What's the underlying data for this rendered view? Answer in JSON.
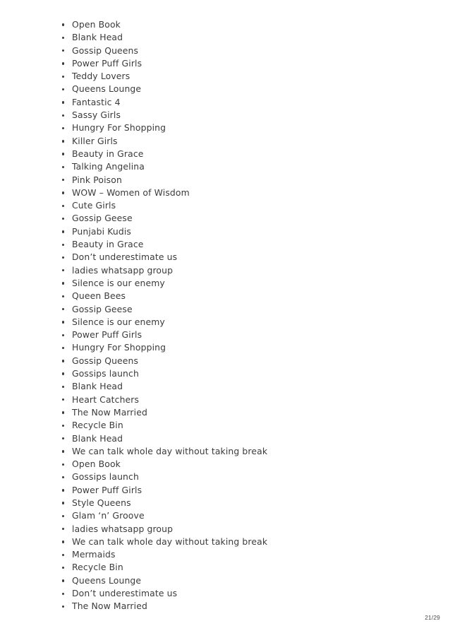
{
  "document": {
    "bullet_icon": "bullet-dot-icon",
    "list": {
      "items": [
        {
          "label": "Open Book"
        },
        {
          "label": "Blank Head"
        },
        {
          "label": "Gossip Queens"
        },
        {
          "label": "Power Puff Girls"
        },
        {
          "label": "Teddy Lovers"
        },
        {
          "label": "Queens Lounge"
        },
        {
          "label": "Fantastic 4"
        },
        {
          "label": "Sassy Girls"
        },
        {
          "label": "Hungry For Shopping"
        },
        {
          "label": "Killer Girls"
        },
        {
          "label": "Beauty in Grace"
        },
        {
          "label": "Talking Angelina"
        },
        {
          "label": "Pink Poison"
        },
        {
          "label": "WOW – Women of Wisdom"
        },
        {
          "label": "Cute Girls"
        },
        {
          "label": "Gossip Geese"
        },
        {
          "label": "Punjabi Kudis"
        },
        {
          "label": "Beauty in Grace"
        },
        {
          "label": "Don’t underestimate us"
        },
        {
          "label": "ladies whatsapp group"
        },
        {
          "label": "Silence is our enemy"
        },
        {
          "label": "Queen Bees"
        },
        {
          "label": "Gossip Geese"
        },
        {
          "label": "Silence is our enemy"
        },
        {
          "label": "Power Puff Girls"
        },
        {
          "label": "Hungry For Shopping"
        },
        {
          "label": "Gossip Queens"
        },
        {
          "label": "Gossips launch"
        },
        {
          "label": "Blank Head"
        },
        {
          "label": "Heart Catchers"
        },
        {
          "label": "The Now Married"
        },
        {
          "label": "Recycle Bin"
        },
        {
          "label": "Blank Head"
        },
        {
          "label": "We can talk whole day without taking break"
        },
        {
          "label": "Open Book"
        },
        {
          "label": "Gossips launch"
        },
        {
          "label": "Power Puff Girls"
        },
        {
          "label": "Style Queens"
        },
        {
          "label": "Glam ‘n’ Groove"
        },
        {
          "label": "ladies whatsapp group"
        },
        {
          "label": "We can talk whole day without taking break"
        },
        {
          "label": "Mermaids"
        },
        {
          "label": "Recycle Bin"
        },
        {
          "label": "Queens Lounge"
        },
        {
          "label": "Don’t underestimate us"
        },
        {
          "label": "The Now Married"
        }
      ]
    },
    "footer": {
      "page_indicator": "21/29"
    }
  }
}
